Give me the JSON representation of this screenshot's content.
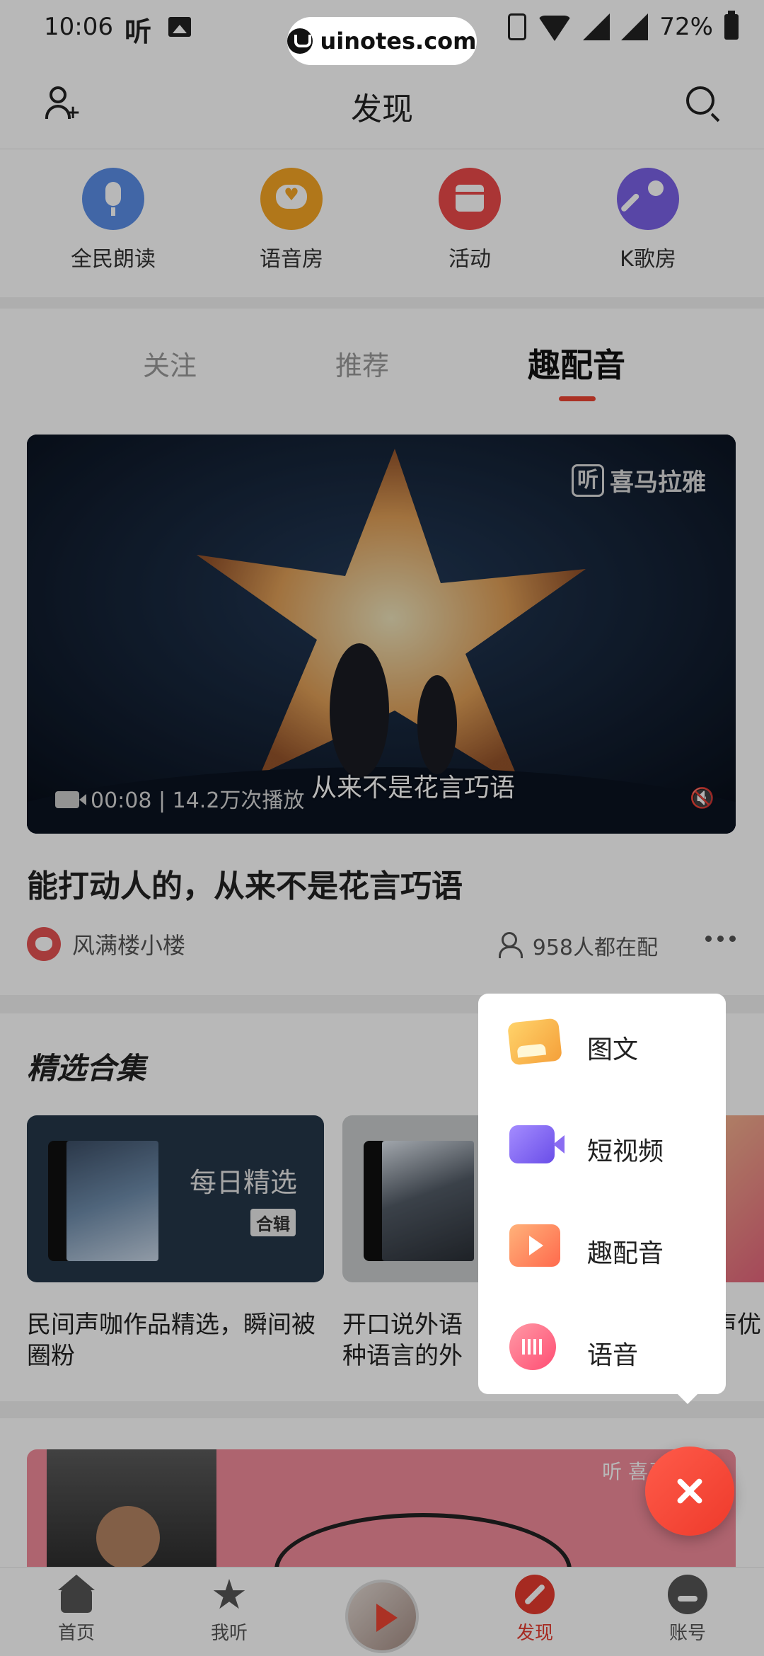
{
  "status_bar": {
    "time": "10:06",
    "app_glyph": "听",
    "battery": "72%",
    "watermark": "uinotes.com"
  },
  "header": {
    "title": "发现",
    "left_icon": "add-user-icon",
    "right_icon": "search-icon"
  },
  "quick_entries": [
    {
      "label": "全民朗读",
      "icon": "microphone-icon",
      "color": "#5a8ee6"
    },
    {
      "label": "语音房",
      "icon": "chat-heart-icon",
      "color": "#f5a524"
    },
    {
      "label": "活动",
      "icon": "calendar-icon",
      "color": "#ec4a4a"
    },
    {
      "label": "K歌房",
      "icon": "karaoke-mic-icon",
      "color": "#7a62e6"
    }
  ],
  "tabs": [
    {
      "label": "关注",
      "active": false
    },
    {
      "label": "推荐",
      "active": false
    },
    {
      "label": "趣配音",
      "active": true
    }
  ],
  "feature": {
    "video_logo_glyph": "听",
    "video_logo_text": "喜马拉雅",
    "video_meta": "00:08 | 14.2万次播放",
    "video_subtitle": "从来不是花言巧语",
    "title": "能打动人的，从来不是花言巧语",
    "author": "风满楼小楼",
    "dub_count": "958人都在配"
  },
  "collections": {
    "heading": "精选合集",
    "items": [
      {
        "cover_title": "每日精选",
        "badge": "合辑",
        "desc": "民间声咖作品精选，瞬间被圈粉"
      },
      {
        "desc": "开口说外语 种语言的外"
      },
      {
        "desc": "声优 每"
      }
    ]
  },
  "next_card": {
    "logo": "听 喜马拉雅"
  },
  "bottom_nav": [
    {
      "label": "首页",
      "icon": "home-icon",
      "active": false
    },
    {
      "label": "我听",
      "icon": "star-icon",
      "active": false
    },
    {
      "label": "发现",
      "icon": "compass-icon",
      "active": true
    },
    {
      "label": "账号",
      "icon": "account-icon",
      "active": false
    }
  ],
  "popup_menu": [
    {
      "label": "图文",
      "icon": "image-text-icon"
    },
    {
      "label": "短视频",
      "icon": "video-camera-icon"
    },
    {
      "label": "趣配音",
      "icon": "dubbing-icon"
    },
    {
      "label": "语音",
      "icon": "voice-bubble-icon"
    }
  ],
  "colors": {
    "accent": "#e63b2e",
    "overlay": "rgba(0,0,0,0.28)"
  }
}
